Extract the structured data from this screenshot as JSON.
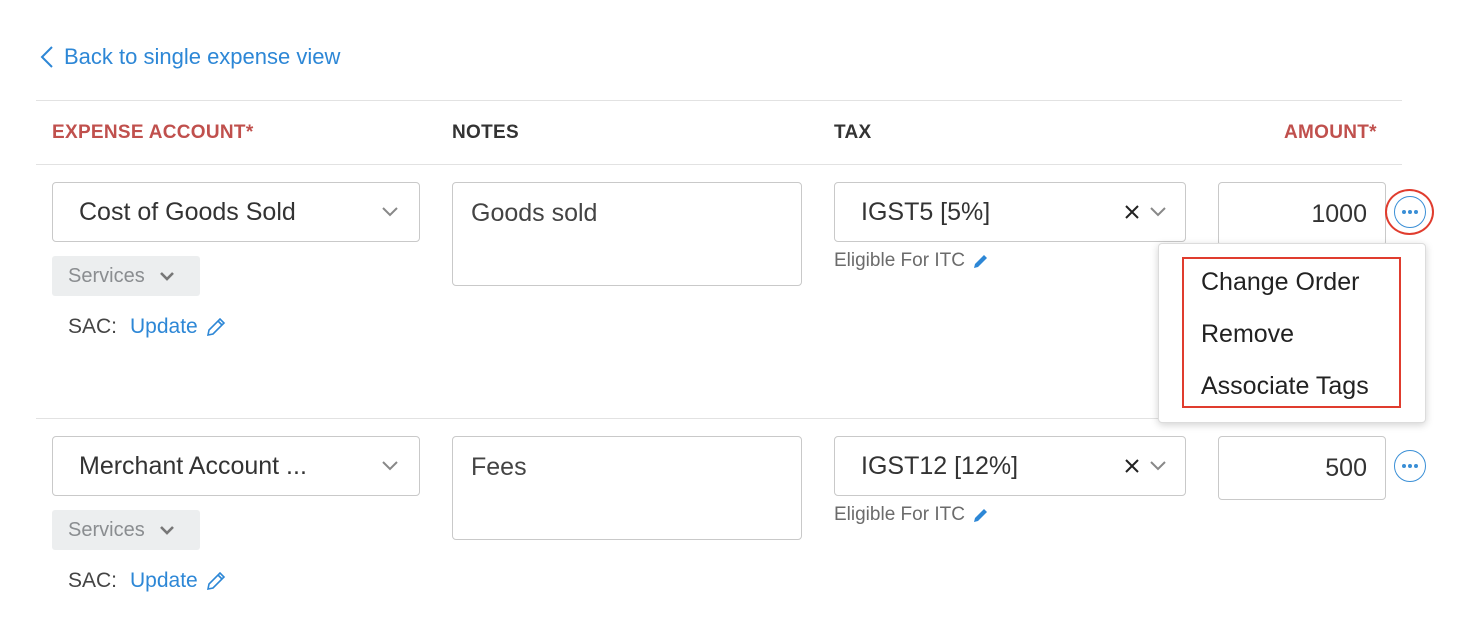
{
  "back_link": "Back to single expense view",
  "columns": {
    "expense_account": "EXPENSE ACCOUNT*",
    "notes": "NOTES",
    "tax": "TAX",
    "amount": "AMOUNT*"
  },
  "rows": [
    {
      "account": "Cost of Goods Sold",
      "tag": "Services",
      "sac_label": "SAC:",
      "sac_link": "Update",
      "notes": "Goods sold",
      "tax": "IGST5 [5%]",
      "itc": "Eligible For ITC",
      "amount": "1000"
    },
    {
      "account": "Merchant Account ...",
      "tag": "Services",
      "sac_label": "SAC:",
      "sac_link": "Update",
      "notes": "Fees",
      "tax": "IGST12 [12%]",
      "itc": "Eligible For ITC",
      "amount": "500"
    }
  ],
  "menu": {
    "items": [
      "Change Order",
      "Remove",
      "Associate Tags"
    ]
  },
  "colors": {
    "link": "#2d87d6",
    "required_header": "#c0504d",
    "highlight": "#e03c2e"
  },
  "icons": [
    "chevron-left-icon",
    "chevron-down-icon",
    "close-icon",
    "pencil-icon",
    "more-icon"
  ]
}
